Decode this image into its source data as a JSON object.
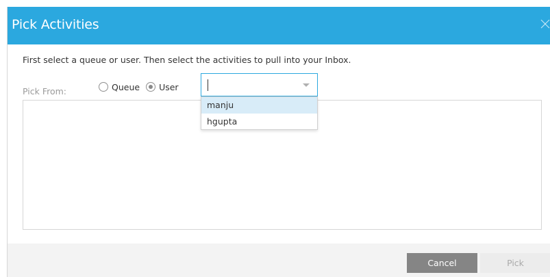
{
  "dialog": {
    "title": "Pick Activities",
    "close_icon": "close-icon",
    "instruction": "First select a queue or user. Then select the activities to pull into your Inbox.",
    "pick_from_label": "Pick From:",
    "radios": [
      {
        "label": "Queue",
        "checked": false
      },
      {
        "label": "User",
        "checked": true
      }
    ],
    "user_select": {
      "value": "",
      "options": [
        "manju",
        "hgupta"
      ],
      "highlighted": "manju"
    },
    "buttons": {
      "cancel": "Cancel",
      "pick": "Pick"
    }
  },
  "colors": {
    "header": "#2ba8df",
    "cancel_bg": "#858585",
    "pick_bg": "#ececec",
    "highlight": "#d8ecf8"
  }
}
